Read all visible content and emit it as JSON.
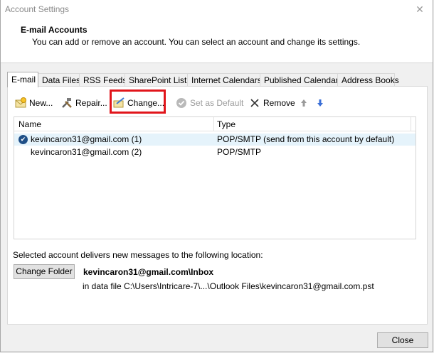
{
  "window": {
    "title": "Account Settings"
  },
  "header": {
    "title": "E-mail Accounts",
    "description": "You can add or remove an account. You can select an account and change its settings."
  },
  "tabs": [
    {
      "label": "E-mail"
    },
    {
      "label": "Data Files"
    },
    {
      "label": "RSS Feeds"
    },
    {
      "label": "SharePoint Lists"
    },
    {
      "label": "Internet Calendars"
    },
    {
      "label": "Published Calendars"
    },
    {
      "label": "Address Books"
    }
  ],
  "toolbar": {
    "new_label": "New...",
    "repair_label": "Repair...",
    "change_label": "Change...",
    "default_label": "Set as Default",
    "remove_label": "Remove"
  },
  "grid": {
    "columns": {
      "name": "Name",
      "type": "Type"
    },
    "rows": [
      {
        "name": "kevincaron31@gmail.com (1)",
        "type": "POP/SMTP (send from this account by default)"
      },
      {
        "name": "kevincaron31@gmail.com (2)",
        "type": "POP/SMTP"
      }
    ]
  },
  "delivery": {
    "label": "Selected account delivers new messages to the following location:",
    "button": "Change Folder",
    "folder": "kevincaron31@gmail.com\\Inbox",
    "datafile": "in data file C:\\Users\\Intricare-7\\...\\Outlook Files\\kevincaron31@gmail.com.pst"
  },
  "footer": {
    "close_label": "Close"
  },
  "colors": {
    "highlight": "#e1151b",
    "selected_row": "#e5f3fb",
    "arrow_up": "#9a9a9a",
    "arrow_down": "#3b6fd6"
  }
}
